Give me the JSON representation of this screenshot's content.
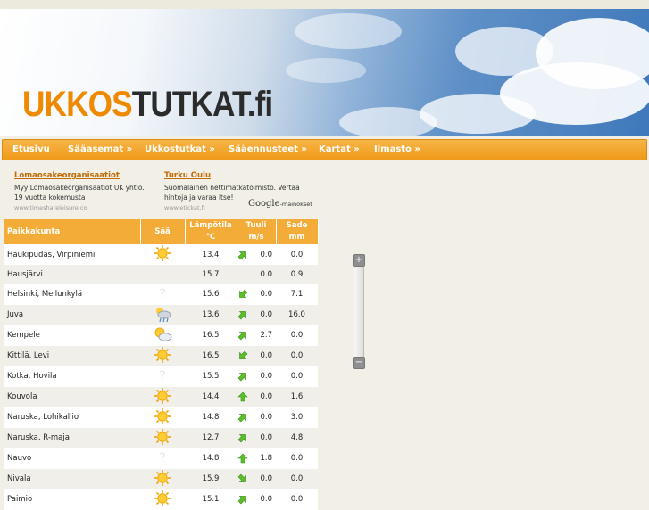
{
  "site": {
    "logo_part1": "UKKOS",
    "logo_part2": "TUTKAT.fi"
  },
  "menu": [
    {
      "label": "Etusivu"
    },
    {
      "label": "Sääasemat »"
    },
    {
      "label": "Ukkostutkat »"
    },
    {
      "label": "Sääennusteet »"
    },
    {
      "label": "Kartat »"
    },
    {
      "label": "Ilmasto »"
    }
  ],
  "ads": [
    {
      "title": "Lomaosakeorganisaatiot",
      "text": "Myy Lomaosakeorganisaatiot UK yhtiö. 19 vuotta kokemusta",
      "url": "www.timeshareleisure.co"
    },
    {
      "title": "Turku Oulu",
      "text": "Suomalainen nettimatkatoimisto. Vertaa hintoja ja varaa itse!",
      "url": "www.etickat.fi"
    }
  ],
  "google_ads_label": {
    "brand": "Google",
    "suffix": "-mainokset"
  },
  "table": {
    "headers": {
      "place": "Paikkakunta",
      "weather": "Sää",
      "temp": "Lämpötila",
      "temp_unit": "°C",
      "wind": "Tuuli",
      "wind_unit": "m/s",
      "rain": "Sade",
      "rain_unit": "mm"
    },
    "rows": [
      {
        "place": "Haukipudas, Virpiniemi",
        "icon": "sun",
        "temp": "13.4",
        "wind_dir": "ne",
        "wind": "0.0",
        "rain": "0.0"
      },
      {
        "place": "Hausjärvi",
        "icon": "none",
        "temp": "15.7",
        "wind_dir": "none",
        "wind": "0.0",
        "rain": "0.9"
      },
      {
        "place": "Helsinki, Mellunkylä",
        "icon": "unknown",
        "temp": "15.6",
        "wind_dir": "sw",
        "wind": "0.0",
        "rain": "7.1"
      },
      {
        "place": "Juva",
        "icon": "rain-cloud",
        "temp": "13.6",
        "wind_dir": "ne",
        "wind": "0.0",
        "rain": "16.0"
      },
      {
        "place": "Kempele",
        "icon": "partly-cloudy",
        "temp": "16.5",
        "wind_dir": "ne",
        "wind": "2.7",
        "rain": "0.0"
      },
      {
        "place": "Kittilä, Levi",
        "icon": "sun",
        "temp": "16.5",
        "wind_dir": "sw",
        "wind": "0.0",
        "rain": "0.0"
      },
      {
        "place": "Kotka, Hovila",
        "icon": "unknown",
        "temp": "15.5",
        "wind_dir": "ne",
        "wind": "0.0",
        "rain": "0.0"
      },
      {
        "place": "Kouvola",
        "icon": "sun",
        "temp": "14.4",
        "wind_dir": "n",
        "wind": "0.0",
        "rain": "1.6"
      },
      {
        "place": "Naruska, Lohikallio",
        "icon": "sun",
        "temp": "14.8",
        "wind_dir": "ne",
        "wind": "0.0",
        "rain": "3.0"
      },
      {
        "place": "Naruska, R-maja",
        "icon": "sun",
        "temp": "12.7",
        "wind_dir": "ne",
        "wind": "0.0",
        "rain": "4.8"
      },
      {
        "place": "Nauvo",
        "icon": "unknown",
        "temp": "14.8",
        "wind_dir": "n",
        "wind": "1.8",
        "rain": "0.0"
      },
      {
        "place": "Nivala",
        "icon": "sun",
        "temp": "15.9",
        "wind_dir": "se",
        "wind": "0.0",
        "rain": "0.0"
      },
      {
        "place": "Paimio",
        "icon": "sun",
        "temp": "15.1",
        "wind_dir": "ne",
        "wind": "0.0",
        "rain": "0.0"
      }
    ]
  },
  "map_zoom": {
    "plus": "+",
    "minus": "−"
  },
  "colors": {
    "accent": "#f4a52a",
    "logo_orange": "#ef8a00"
  }
}
